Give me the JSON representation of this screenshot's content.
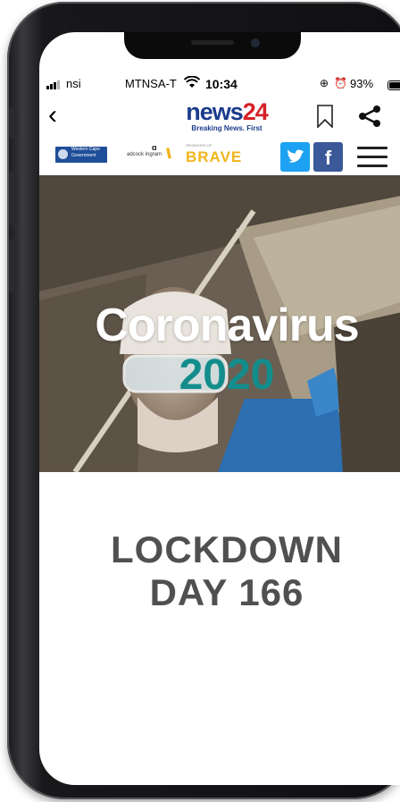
{
  "status": {
    "carrier_left": "nsi",
    "carrier_right": "MTNSA-T",
    "time": "10:34",
    "battery": "93%"
  },
  "header": {
    "logo_part1": "news",
    "logo_part2": "24",
    "tagline": "Breaking News. First"
  },
  "sponsors": {
    "western_cape_line1": "Western Cape",
    "western_cape_line2": "Government",
    "adcock": "adcock ingram",
    "brave_prefix": "SPONSORS OF",
    "brave": "BRAVE"
  },
  "hero": {
    "title": "Coronavirus",
    "year": "2020"
  },
  "lockdown": {
    "line1": "LOCKDOWN",
    "line2": "DAY 166"
  },
  "colors": {
    "news_blue": "#1b3c8c",
    "news_red": "#d62027",
    "twitter": "#1da1f2",
    "facebook": "#3b5998",
    "teal": "#138d8c",
    "brave_yellow": "#f1b51c"
  },
  "icons": [
    "back-arrow-icon",
    "bookmark-icon",
    "share-icon",
    "twitter-icon",
    "facebook-icon",
    "hamburger-menu-icon",
    "wifi-icon",
    "alarm-icon"
  ]
}
